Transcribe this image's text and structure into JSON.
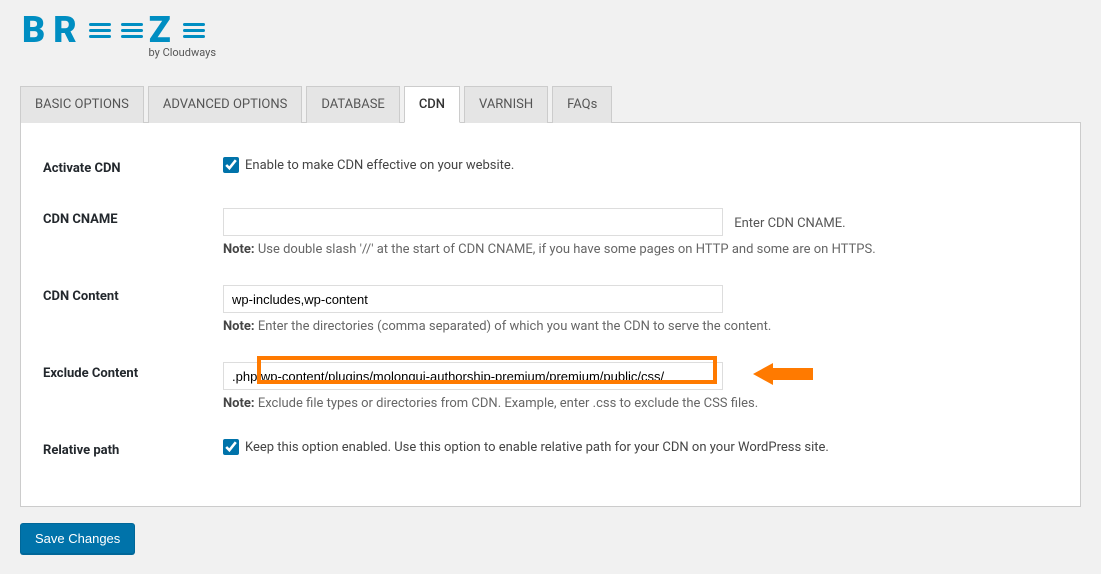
{
  "logo": {
    "brand": "BREEZE",
    "byline": "by Cloudways"
  },
  "tabs": [
    {
      "label": "BASIC OPTIONS"
    },
    {
      "label": "ADVANCED OPTIONS"
    },
    {
      "label": "DATABASE"
    },
    {
      "label": "CDN"
    },
    {
      "label": "VARNISH"
    },
    {
      "label": "FAQs"
    }
  ],
  "active_tab_index": 3,
  "form": {
    "activate_cdn": {
      "label": "Activate CDN",
      "desc": "Enable to make CDN effective on your website."
    },
    "cdn_cname": {
      "label": "CDN CNAME",
      "value": "",
      "after": "Enter CDN CNAME.",
      "note_label": "Note:",
      "note": "Use double slash '//' at the start of CDN CNAME, if you have some pages on HTTP and some are on HTTPS."
    },
    "cdn_content": {
      "label": "CDN Content",
      "value": "wp-includes,wp-content",
      "note_label": "Note:",
      "note": "Enter the directories (comma separated) of which you want the CDN to serve the content."
    },
    "exclude_content": {
      "label": "Exclude Content",
      "value": ".php,wp-content/plugins/molongui-authorship-premium/premium/public/css/",
      "note_label": "Note:",
      "note": "Exclude file types or directories from CDN. Example, enter .css to exclude the CSS files."
    },
    "relative_path": {
      "label": "Relative path",
      "desc": "Keep this option enabled. Use this option to enable relative path for your CDN on your WordPress site."
    }
  },
  "save_button": "Save Changes"
}
